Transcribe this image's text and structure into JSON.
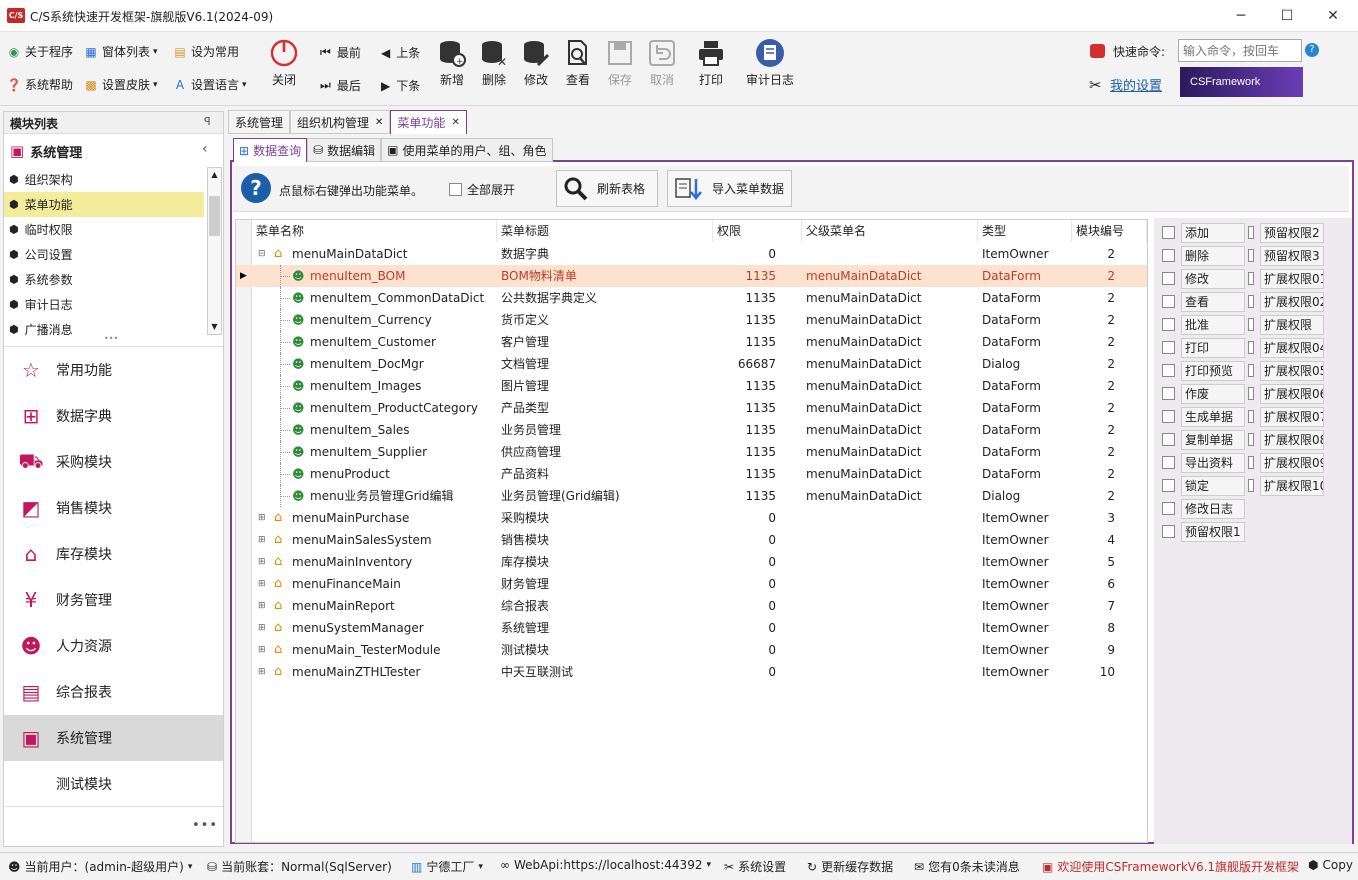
{
  "window": {
    "title": "C/S系统快速开发框架-旗舰版V6.1(2024-09)",
    "logo": "C/S",
    "min": "─",
    "max": "☐",
    "close": "✕"
  },
  "ribbon": {
    "left": [
      {
        "label": "关于程序",
        "icon": "info-icon"
      },
      {
        "label": "窗体列表",
        "icon": "windows-icon"
      },
      {
        "label": "设为常用",
        "icon": "pin-icon"
      },
      {
        "label": "系统帮助",
        "icon": "help-icon"
      },
      {
        "label": "设置皮肤",
        "icon": "skin-icon"
      },
      {
        "label": "设置语言",
        "icon": "language-icon"
      }
    ],
    "close": "关闭",
    "nav": [
      "最前",
      "上条",
      "最后",
      "下条"
    ],
    "actions": [
      "新增",
      "删除",
      "修改",
      "查看",
      "保存",
      "取消",
      "打印",
      "审计日志"
    ],
    "quick_command_label": "快速命令:",
    "quick_command_placeholder": "输入命令，按回车",
    "my_settings": "我的设置",
    "brand": "CSFramework"
  },
  "left_panel": {
    "title": "模块列表",
    "pin": "ꟼ",
    "group": "系统管理",
    "items": [
      "组织架构",
      "菜单功能",
      "临时权限",
      "公司设置",
      "系统参数",
      "审计日志",
      "广播消息"
    ],
    "selected": "菜单功能",
    "nav": [
      "常用功能",
      "数据字典",
      "采购模块",
      "销售模块",
      "库存模块",
      "财务管理",
      "人力资源",
      "综合报表",
      "系统管理",
      "测试模块"
    ],
    "nav_selected": "系统管理",
    "more": "•••"
  },
  "tabs": [
    {
      "label": "系统管理",
      "closable": false
    },
    {
      "label": "组织机构管理",
      "closable": true
    },
    {
      "label": "菜单功能",
      "closable": true,
      "active": true
    }
  ],
  "subtabs": [
    "数据查询",
    "数据编辑",
    "使用菜单的用户、组、角色"
  ],
  "toolbar": {
    "tip": "点鼠标右键弹出功能菜单。",
    "expand_all": "全部展开",
    "refresh": "刷新表格",
    "import": "导入菜单数据"
  },
  "grid": {
    "headers": [
      "菜单名称",
      "菜单标题",
      "权限",
      "父级菜单名",
      "类型",
      "模块编号"
    ],
    "rows": [
      {
        "name": "menuMainDataDict",
        "title": "数据字典",
        "perm": "0",
        "parent": "",
        "type": "ItemOwner",
        "module": "2",
        "level": 0,
        "expanded": true
      },
      {
        "name": "menuItem_BOM",
        "title": "BOM物料清单",
        "perm": "1135",
        "parent": "menuMainDataDict",
        "type": "DataForm",
        "module": "2",
        "level": 1,
        "selected": true
      },
      {
        "name": "menuItem_CommonDataDict",
        "title": "公共数据字典定义",
        "perm": "1135",
        "parent": "menuMainDataDict",
        "type": "DataForm",
        "module": "2",
        "level": 1
      },
      {
        "name": "menuItem_Currency",
        "title": "货币定义",
        "perm": "1135",
        "parent": "menuMainDataDict",
        "type": "DataForm",
        "module": "2",
        "level": 1
      },
      {
        "name": "menuItem_Customer",
        "title": "客户管理",
        "perm": "1135",
        "parent": "menuMainDataDict",
        "type": "DataForm",
        "module": "2",
        "level": 1
      },
      {
        "name": "menuItem_DocMgr",
        "title": "文档管理",
        "perm": "66687",
        "parent": "menuMainDataDict",
        "type": "Dialog",
        "module": "2",
        "level": 1
      },
      {
        "name": "menuItem_Images",
        "title": "图片管理",
        "perm": "1135",
        "parent": "menuMainDataDict",
        "type": "DataForm",
        "module": "2",
        "level": 1
      },
      {
        "name": "menuItem_ProductCategory",
        "title": "产品类型",
        "perm": "1135",
        "parent": "menuMainDataDict",
        "type": "DataForm",
        "module": "2",
        "level": 1
      },
      {
        "name": "menuItem_Sales",
        "title": "业务员管理",
        "perm": "1135",
        "parent": "menuMainDataDict",
        "type": "DataForm",
        "module": "2",
        "level": 1
      },
      {
        "name": "menuItem_Supplier",
        "title": "供应商管理",
        "perm": "1135",
        "parent": "menuMainDataDict",
        "type": "DataForm",
        "module": "2",
        "level": 1
      },
      {
        "name": "menuProduct",
        "title": "产品资料",
        "perm": "1135",
        "parent": "menuMainDataDict",
        "type": "DataForm",
        "module": "2",
        "level": 1
      },
      {
        "name": "menu业务员管理Grid编辑",
        "title": "业务员管理(Grid编辑)",
        "perm": "1135",
        "parent": "menuMainDataDict",
        "type": "Dialog",
        "module": "2",
        "level": 1
      },
      {
        "name": "menuMainPurchase",
        "title": "采购模块",
        "perm": "0",
        "parent": "",
        "type": "ItemOwner",
        "module": "3",
        "level": 0
      },
      {
        "name": "menuMainSalesSystem",
        "title": "销售模块",
        "perm": "0",
        "parent": "",
        "type": "ItemOwner",
        "module": "4",
        "level": 0
      },
      {
        "name": "menuMainInventory",
        "title": "库存模块",
        "perm": "0",
        "parent": "",
        "type": "ItemOwner",
        "module": "5",
        "level": 0
      },
      {
        "name": "menuFinanceMain",
        "title": "财务管理",
        "perm": "0",
        "parent": "",
        "type": "ItemOwner",
        "module": "6",
        "level": 0
      },
      {
        "name": "menuMainReport",
        "title": "综合报表",
        "perm": "0",
        "parent": "",
        "type": "ItemOwner",
        "module": "7",
        "level": 0
      },
      {
        "name": "menuSystemManager",
        "title": "系统管理",
        "perm": "0",
        "parent": "",
        "type": "ItemOwner",
        "module": "8",
        "level": 0
      },
      {
        "name": "menuMain_TesterModule",
        "title": "测试模块",
        "perm": "0",
        "parent": "",
        "type": "ItemOwner",
        "module": "9",
        "level": 0
      },
      {
        "name": "menuMainZTHLTester",
        "title": "中天互联测试",
        "perm": "0",
        "parent": "",
        "type": "ItemOwner",
        "module": "10",
        "level": 0
      }
    ]
  },
  "permissions": {
    "col1": [
      "添加",
      "删除",
      "修改",
      "查看",
      "批准",
      "打印",
      "打印预览",
      "作废",
      "生成单据",
      "复制单据",
      "导出资料",
      "锁定",
      "修改日志",
      "预留权限1"
    ],
    "col2": [
      "预留权限2",
      "预留权限3",
      "扩展权限01",
      "扩展权限02",
      "扩展权限",
      "扩展权限04",
      "扩展权限05",
      "扩展权限06",
      "扩展权限07",
      "扩展权限08",
      "扩展权限09",
      "扩展权限10"
    ]
  },
  "status": {
    "user": "当前用户：(admin-超级用户)",
    "account": "当前账套：Normal(SqlServer)",
    "factory": "宁德工厂",
    "webapi": "WebApi:https://localhost:44392",
    "settings": "系统设置",
    "refresh_cache": "更新缓存数据",
    "messages": "您有0条未读消息",
    "welcome": "欢迎使用CSFrameworkV6.1旗舰版开发框架",
    "copy": "Copy"
  },
  "colors": {
    "accent": "#7f3f98",
    "selected_row": "#fde3cf",
    "selected_text": "#c0392b",
    "highlight": "#f3ec9a"
  }
}
